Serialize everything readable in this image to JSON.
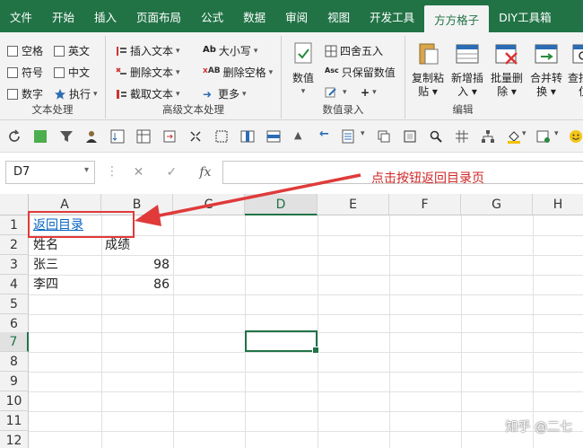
{
  "tabs": [
    "文件",
    "开始",
    "插入",
    "页面布局",
    "公式",
    "数据",
    "审阅",
    "视图",
    "开发工具",
    "方方格子",
    "DIY工具箱"
  ],
  "ribbon": {
    "text_group": {
      "label": "文本处理",
      "checkboxes": [
        "空格",
        "英文",
        "符号",
        "中文",
        "数字"
      ],
      "execute": "执行"
    },
    "advanced_group": {
      "label": "高级文本处理",
      "insert_text": "插入文本",
      "delete_text": "删除文本",
      "extract_text": "截取文本",
      "case": "大小写",
      "delete_spaces": "删除空格",
      "more": "更多"
    },
    "numeric_group": {
      "label": "数值录入",
      "value_button": "数值",
      "round": "四舍五入",
      "keep_values": "只保留数值",
      "plus": "+"
    },
    "edit_group": {
      "label": "编辑",
      "copy_paste": [
        "复制粘",
        "贴"
      ],
      "new_insert": [
        "新增插",
        "入"
      ],
      "batch_delete": [
        "批量删",
        "除"
      ],
      "merge_convert": [
        "合并转",
        "换"
      ],
      "find_locate": [
        "查找定",
        "位"
      ]
    }
  },
  "namebox": "D7",
  "annotation": "点击按钮返回目录页",
  "columns": [
    "A",
    "B",
    "C",
    "D",
    "E",
    "F",
    "G",
    "H"
  ],
  "rows": [
    "1",
    "2",
    "3",
    "4",
    "5",
    "6",
    "7",
    "8",
    "9",
    "10",
    "11",
    "12"
  ],
  "cells": {
    "a1": "返回目录",
    "a2": "姓名",
    "b2": "成绩",
    "a3": "张三",
    "b3": "98",
    "a4": "李四",
    "b4": "86"
  },
  "watermark": "知乎 @二七",
  "colors": {
    "excel_green": "#217346",
    "annotation_red": "#d02525",
    "link_blue": "#0563c1"
  }
}
